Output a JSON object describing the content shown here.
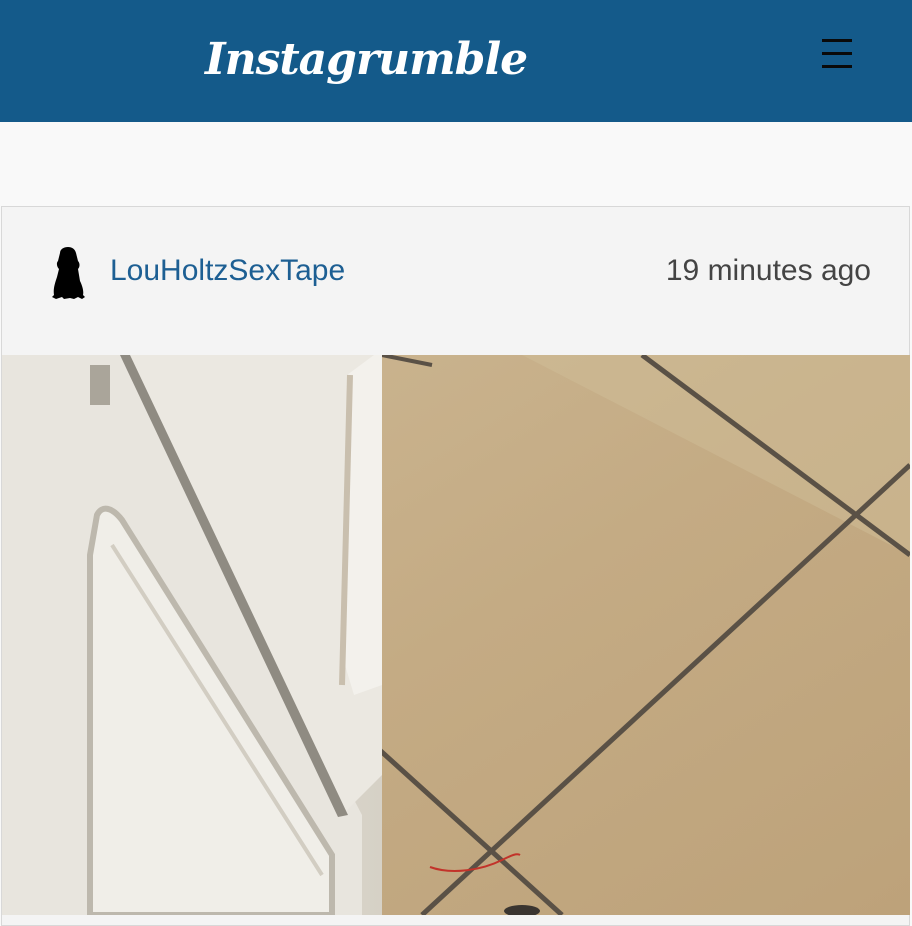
{
  "header": {
    "brand": "Instagrumble",
    "menu_icon": "hamburger-menu-icon"
  },
  "post": {
    "username": "LouHoltzSexTape",
    "timestamp": "19 minutes ago",
    "avatar_icon": "pug-silhouette-icon",
    "photo": "photo of white cabinet corner on beige tile floor"
  },
  "colors": {
    "header_bg": "#145a8a",
    "username": "#1d5f93",
    "timestamp": "#444444",
    "card_bg": "#f4f4f4"
  }
}
